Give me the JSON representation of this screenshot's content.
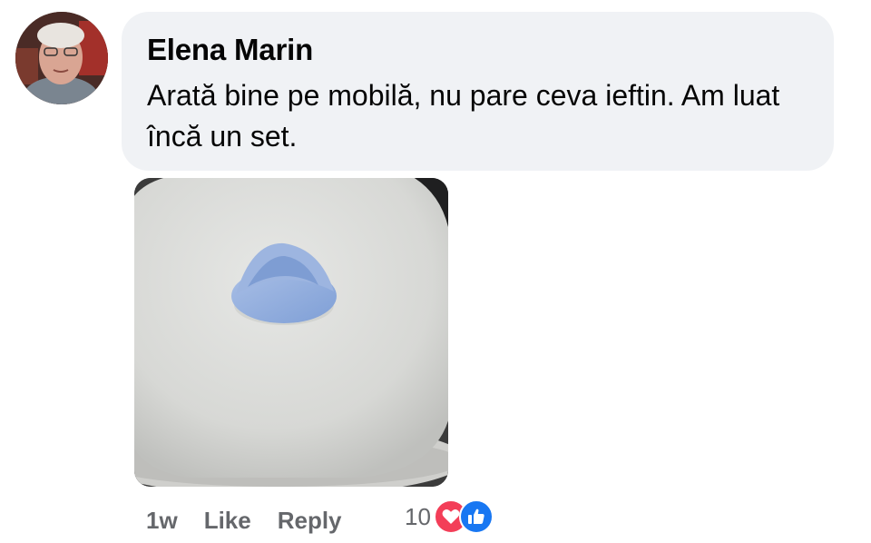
{
  "comment": {
    "author": "Elena Marin",
    "text": "Arată bine pe mobilă, nu pare ceva ieftin. Am luat încă un set.",
    "avatar_icon": "user-avatar-photo",
    "attachment_icon": "photo-attachment"
  },
  "actions": {
    "time": "1w",
    "like_label": "Like",
    "reply_label": "Reply"
  },
  "reactions": {
    "count": "10",
    "types": [
      "love",
      "like"
    ],
    "colors": {
      "love": "#f33e58",
      "like": "#1877f2"
    }
  },
  "colors": {
    "bubble_bg": "#f0f2f5",
    "secondary_text": "#65676b",
    "primary_text": "#050505"
  }
}
